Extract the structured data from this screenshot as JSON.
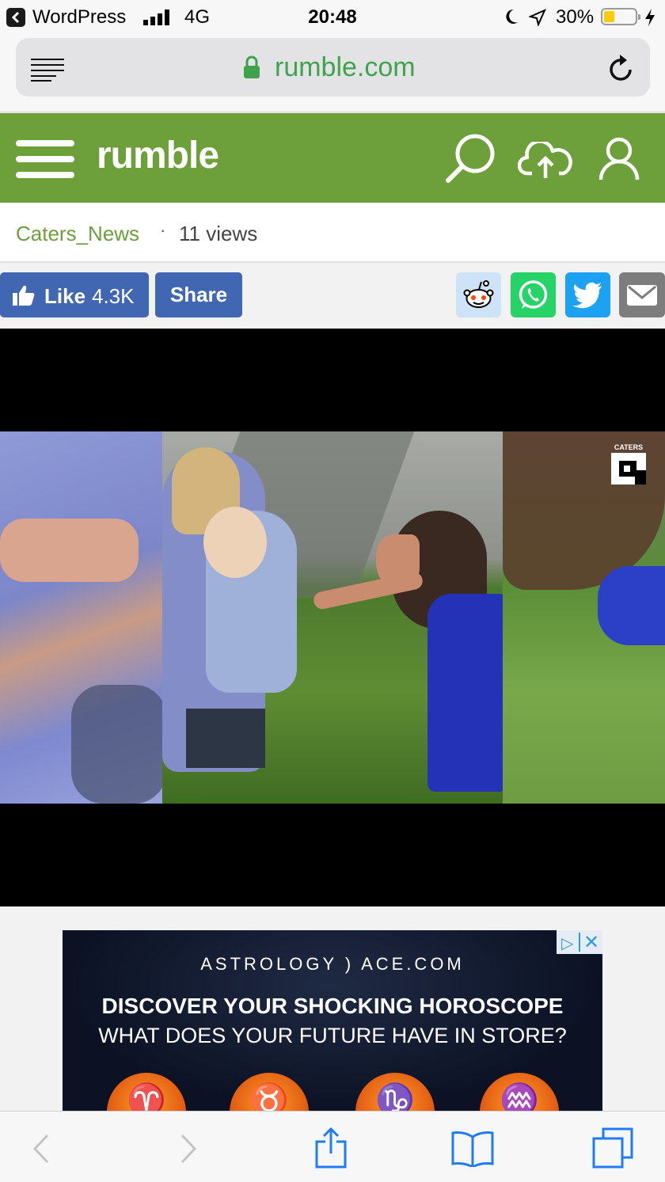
{
  "status_bar": {
    "back_app": "WordPress",
    "network": "4G",
    "time": "20:48",
    "battery": "30%"
  },
  "browser": {
    "url": "rumble.com"
  },
  "site": {
    "logo": "rumble",
    "brand_color": "#6d9f3a"
  },
  "video_meta": {
    "channel": "Caters_News",
    "separator": "·",
    "views": "11 views"
  },
  "actions": {
    "like_label": "Like",
    "like_count": "4.3K",
    "share_label": "Share",
    "share_color": "#4267b2"
  },
  "video": {
    "watermark": "CATERS"
  },
  "ad": {
    "brand": "ASTROLOGY ) ACE.COM",
    "headline": "DISCOVER YOUR SHOCKING HOROSCOPE",
    "subline": "WHAT DOES YOUR FUTURE HAVE IN STORE?",
    "zodiac_signs": [
      "♈",
      "♉",
      "♑",
      "♒"
    ]
  }
}
